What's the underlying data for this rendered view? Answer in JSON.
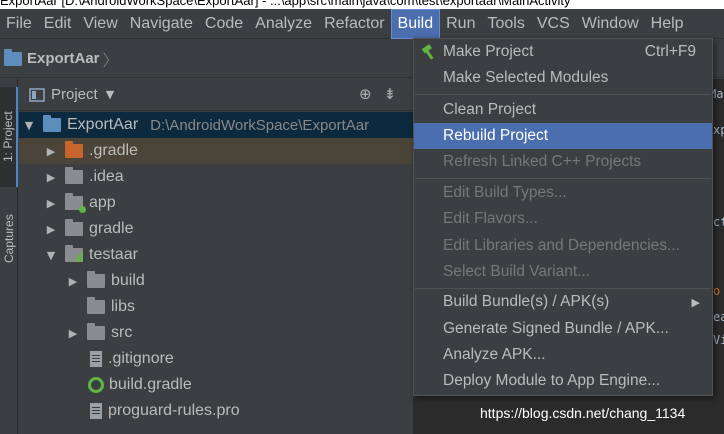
{
  "window": {
    "title": "ExportAar [D:\\AndroidWorkSpace\\ExportAar] - ...\\app\\src\\main\\java\\com\\test\\exportaar\\MainActivity"
  },
  "menubar": {
    "items": [
      "File",
      "Edit",
      "View",
      "Navigate",
      "Code",
      "Analyze",
      "Refactor",
      "Build",
      "Run",
      "Tools",
      "VCS",
      "Window",
      "Help"
    ],
    "active": "Build"
  },
  "navbar": {
    "project": "ExportAar"
  },
  "stripe": {
    "project_tab": "1: Project",
    "captures_tab": "Captures"
  },
  "panel": {
    "title": "Project"
  },
  "tree": [
    {
      "label": "ExportAar",
      "path": "D:\\AndroidWorkSpace\\ExportAar"
    },
    {
      "label": ".gradle"
    },
    {
      "label": ".idea"
    },
    {
      "label": "app"
    },
    {
      "label": "gradle"
    },
    {
      "label": "testaar"
    },
    {
      "label": "build"
    },
    {
      "label": "libs"
    },
    {
      "label": "src"
    },
    {
      "label": ".gitignore"
    },
    {
      "label": "build.gradle"
    },
    {
      "label": "proguard-rules.pro"
    }
  ],
  "build_menu": {
    "make_project": "Make Project",
    "make_project_shortcut": "Ctrl+F9",
    "make_selected_modules": "Make Selected Modules",
    "clean_project": "Clean Project",
    "rebuild_project": "Rebuild Project",
    "refresh_linked_cpp": "Refresh Linked C++ Projects",
    "edit_build_types": "Edit Build Types...",
    "edit_flavors": "Edit Flavors...",
    "edit_libraries": "Edit Libraries and Dependencies...",
    "select_build_variant": "Select Build Variant...",
    "build_bundles": "Build Bundle(s) / APK(s)",
    "generate_signed": "Generate Signed Bundle / APK...",
    "analyze_apk": "Analyze APK...",
    "deploy_module": "Deploy Module to App Engine..."
  },
  "editor_fragments": [
    "Ma",
    "xp",
    "ct",
    "o",
    "ea",
    "Vi"
  ],
  "watermark": "https://blog.csdn.net/chang_1134",
  "colors": {
    "accent": "#4b6eaf",
    "background": "#3c3f41",
    "selection": "#0d293e",
    "gradle_green": "#62b543",
    "folder_orange": "#c7652c"
  }
}
